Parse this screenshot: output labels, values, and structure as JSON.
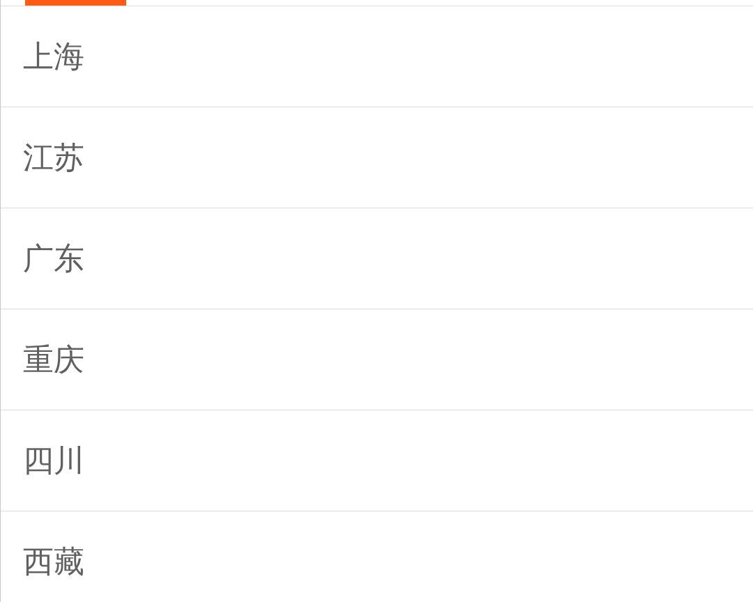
{
  "regions": [
    {
      "name": "上海"
    },
    {
      "name": "江苏"
    },
    {
      "name": "广东"
    },
    {
      "name": "重庆"
    },
    {
      "name": "四川"
    },
    {
      "name": "西藏"
    }
  ]
}
